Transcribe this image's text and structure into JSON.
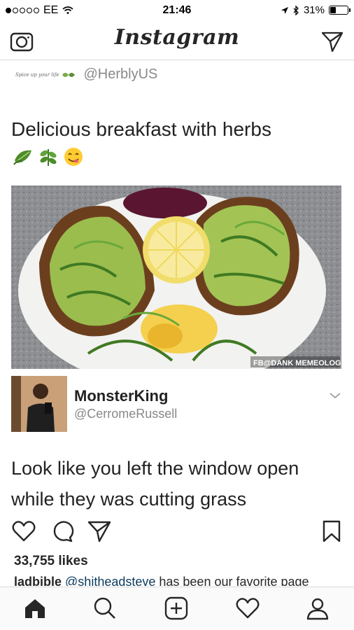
{
  "status_bar": {
    "carrier": "EE",
    "time": "21:46",
    "battery_percent": "31%",
    "battery_level": 0.31
  },
  "header": {
    "brand": "Instagram",
    "icons": {
      "left": "camera-icon",
      "right": "direct-message-icon"
    }
  },
  "post": {
    "tweet": {
      "logo_text": "Spice up your life",
      "handle": "@HerblyUS",
      "text": "Delicious breakfast with herbs",
      "emojis": [
        "herb-leaf-icon",
        "herb-sprig-icon",
        "yum-face-icon"
      ],
      "photo_watermark": "FB@DANK MEMEOLOGY"
    },
    "reply": {
      "name": "MonsterKing",
      "handle": "@CerromeRussell",
      "text_line1": "Look like you left the window open",
      "text_line2": "while they was cutting grass"
    },
    "actions": [
      "heart-icon",
      "comment-icon",
      "share-icon",
      "bookmark-icon"
    ],
    "likes": "33,755 likes",
    "caption": {
      "user": "ladbible",
      "mention": "@shitheadsteve",
      "text": " has been our favorite page"
    }
  },
  "bottom_nav": [
    "home-icon",
    "search-icon",
    "add-post-icon",
    "activity-heart-icon",
    "profile-icon"
  ],
  "colors": {
    "text": "#262626",
    "muted": "#8a8a8a",
    "border": "#dbdbdb",
    "mention": "#0b3a5c"
  }
}
